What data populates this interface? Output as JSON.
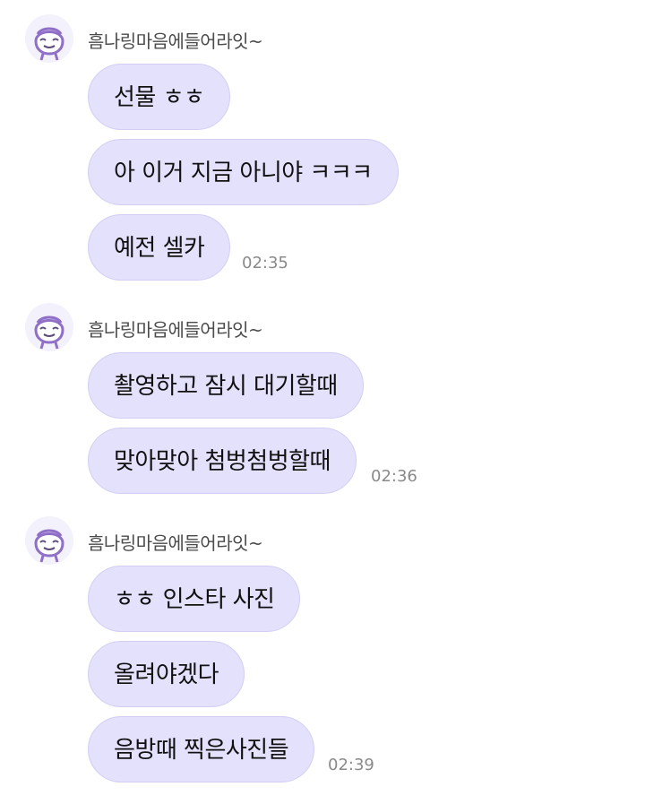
{
  "groups": [
    {
      "sender": "흠나링마음에들어라잇~",
      "messages": [
        "선물 ㅎㅎ",
        "아 이거 지금 아니야 ㅋㅋㅋ",
        "예전 셀카"
      ],
      "time": "02:35"
    },
    {
      "sender": "흠나링마음에들어라잇~",
      "messages": [
        "촬영하고 잠시 대기할때",
        "맞아맞아 첨벙첨벙할때"
      ],
      "time": "02:36"
    },
    {
      "sender": "흠나링마음에들어라잇~",
      "messages": [
        "ㅎㅎ 인스타 사진",
        "올려야겠다",
        "음방때 찍은사진들"
      ],
      "time": "02:39"
    }
  ],
  "colors": {
    "bubble": "#e3e1fb",
    "bubble_border": "#d2cff3",
    "avatar_stroke": "#8f6fc8"
  },
  "icons": {
    "avatar": "cartoon-face-avatar-icon"
  }
}
